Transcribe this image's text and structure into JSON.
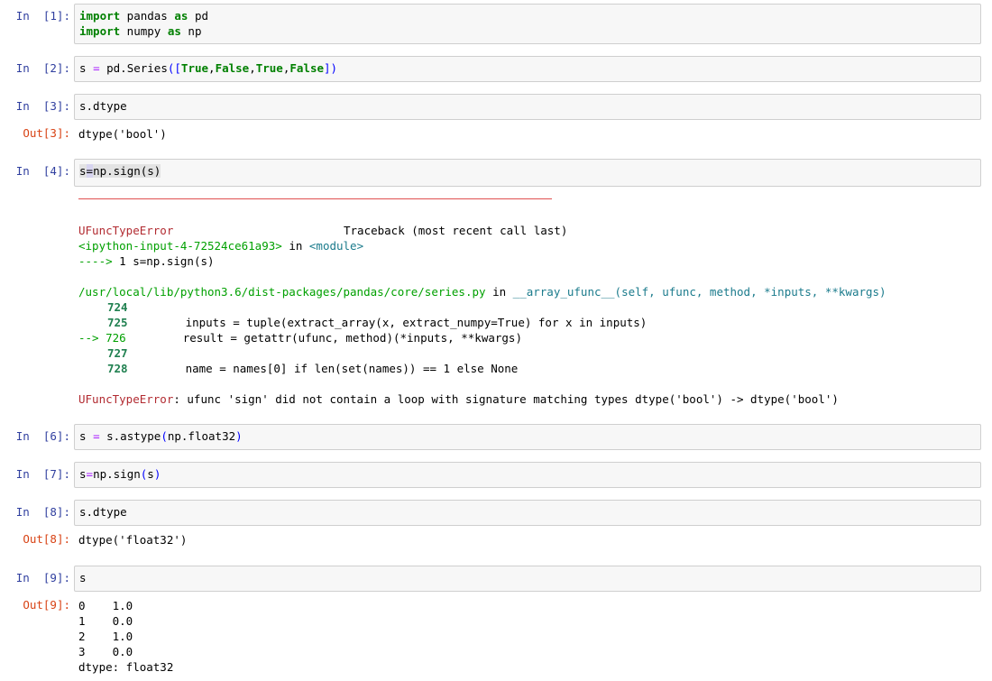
{
  "cells": [
    {
      "prompt": "In  [1]:",
      "code": [
        "import pandas as pd",
        "import numpy as np"
      ]
    },
    {
      "prompt": "In  [2]:",
      "code": [
        "s = pd.Series([True,False,True,False])"
      ]
    },
    {
      "prompt": "In  [3]:",
      "code": [
        "s.dtype"
      ],
      "out_prompt": "Out[3]:",
      "output": "dtype('bool')"
    },
    {
      "prompt": "In  [4]:",
      "code": [
        "s=np.sign(s)"
      ]
    },
    {
      "prompt": "In  [6]:",
      "code": [
        "s = s.astype(np.float32)"
      ]
    },
    {
      "prompt": "In  [7]:",
      "code": [
        "s=np.sign(s)"
      ]
    },
    {
      "prompt": "In  [8]:",
      "code": [
        "s.dtype"
      ],
      "out_prompt": "Out[8]:",
      "output": "dtype('float32')"
    },
    {
      "prompt": "In  [9]:",
      "code": [
        "s"
      ],
      "out_prompt": "Out[9]:",
      "output": [
        "0    1.0",
        "1    0.0",
        "2    1.0",
        "3    0.0",
        "dtype: float32"
      ]
    }
  ],
  "traceback": {
    "error_name": "UFuncTypeError",
    "header_right": "Traceback (most recent call last)",
    "input_ref": "<ipython-input-4-72524ce61a93>",
    "in_word": "in",
    "module": "<module>",
    "arrow_line_prefix": "---->",
    "arrow_line": "1 s=np.sign(s)",
    "file_path": "/usr/local/lib/python3.6/dist-packages/pandas/core/series.py",
    "func": "__array_ufunc__(self, ufunc, method, *inputs, **kwargs)",
    "line_724": "724",
    "line_725": "725",
    "line_725_code": "inputs = tuple(extract_array(x, extract_numpy=True) for x in inputs)",
    "line_726_prefix": "--> 726",
    "line_726_code": "result = getattr(ufunc, method)(*inputs, **kwargs)",
    "line_727": "727",
    "line_728": "728",
    "line_728_code": "name = names[0] if len(set(names)) == 1 else None",
    "error_msg": ": ufunc 'sign' did not contain a loop with signature matching types dtype('bool') -> dtype('bool')"
  }
}
